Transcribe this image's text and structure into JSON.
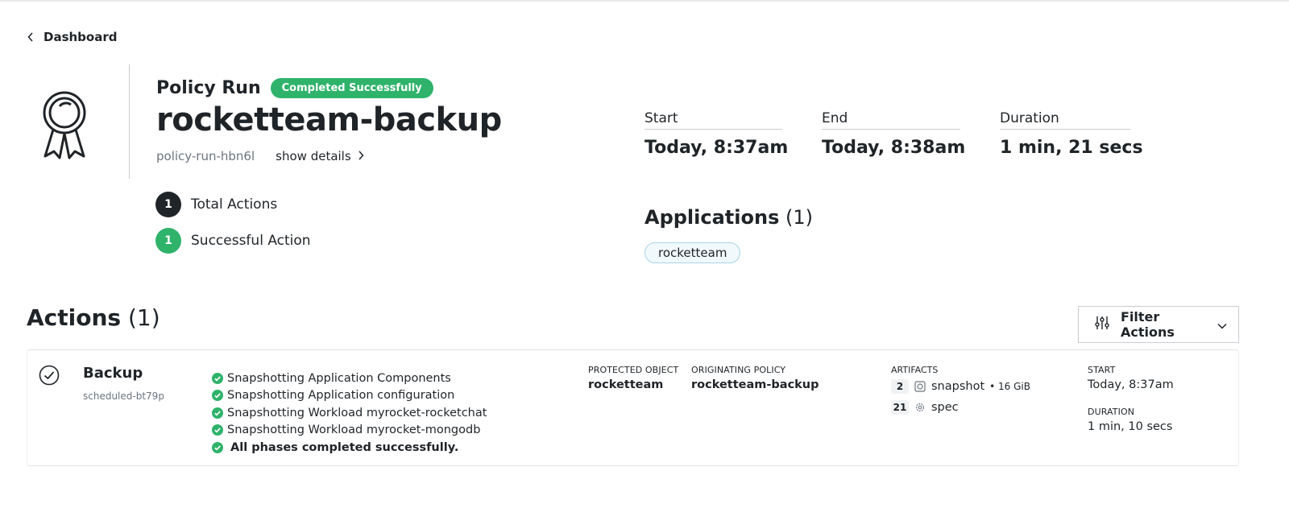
{
  "breadcrumb": {
    "label": "Dashboard"
  },
  "run": {
    "kind": "Policy Run",
    "status": "Completed Successfully",
    "name": "rocketteam-backup",
    "id": "policy-run-hbn6l",
    "show_details": "show details"
  },
  "counts": [
    {
      "number": "1",
      "label": "Total Actions",
      "color": "#1f2428"
    },
    {
      "number": "1",
      "label": "Successful Action",
      "color": "#2fb36b"
    }
  ],
  "stats": {
    "start": {
      "label": "Start",
      "value": "Today, 8:37am"
    },
    "end": {
      "label": "End",
      "value": "Today, 8:38am"
    },
    "duration": {
      "label": "Duration",
      "value": "1 min, 21 secs"
    }
  },
  "applications": {
    "title": "Applications",
    "count": "(1)",
    "items": [
      "rocketteam"
    ]
  },
  "actions": {
    "title": "Actions",
    "count": "(1)",
    "filter_label": "Filter Actions",
    "items": [
      {
        "type": "Backup",
        "id": "scheduled-bt79p",
        "phases": [
          "Snapshotting Application Components",
          "Snapshotting Application configuration",
          "Snapshotting Workload myrocket-rocketchat",
          "Snapshotting Workload myrocket-mongodb",
          "All phases completed successfully."
        ],
        "protected_object_label": "PROTECTED OBJECT",
        "protected_object": "rocketteam",
        "originating_policy_label": "ORIGINATING POLICY",
        "originating_policy": "rocketteam-backup",
        "artifacts_label": "ARTIFACTS",
        "artifacts": [
          {
            "count": "2",
            "icon": "snapshot-icon",
            "name": "snapshot",
            "size": "• 16 GiB"
          },
          {
            "count": "21",
            "icon": "gear-icon",
            "name": "spec",
            "size": ""
          }
        ],
        "start_label": "START",
        "start": "Today, 8:37am",
        "duration_label": "DURATION",
        "duration": "1 min, 10 secs"
      }
    ]
  },
  "colors": {
    "success": "#2fb36b",
    "text": "#1f2428",
    "muted": "#6b7580"
  }
}
